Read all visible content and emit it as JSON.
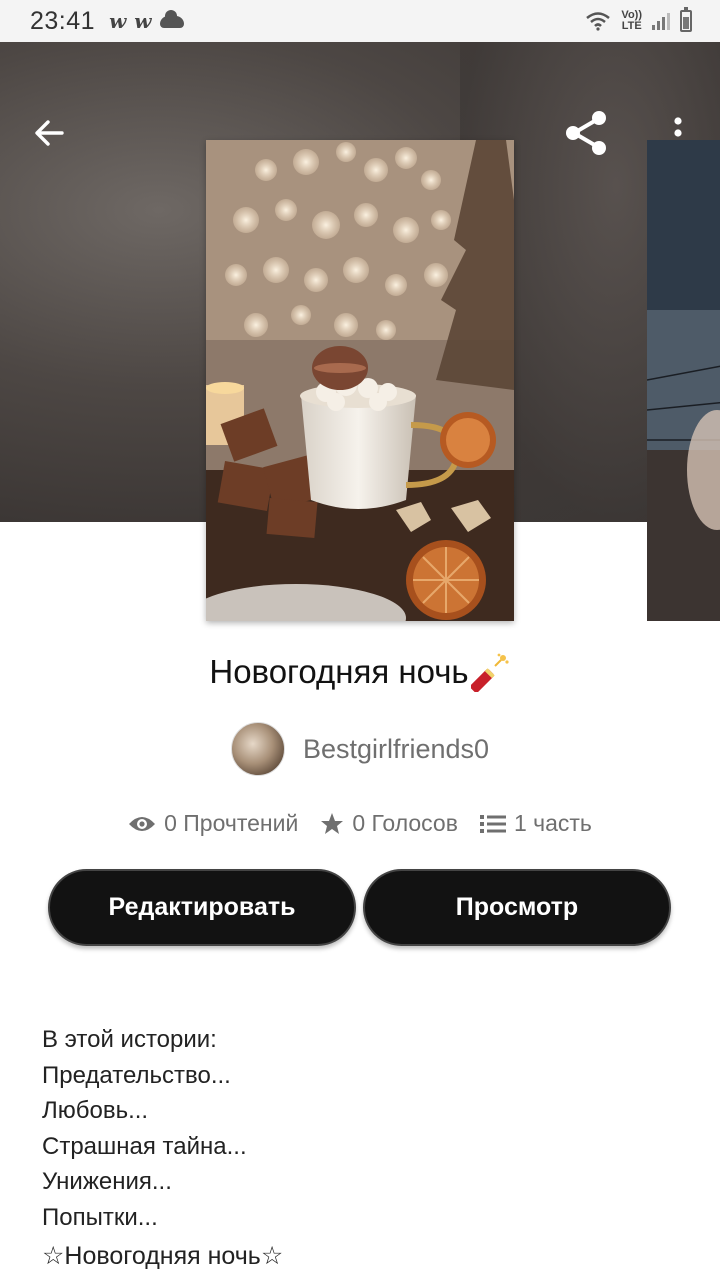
{
  "status_bar": {
    "time": "23:41",
    "left_icons": [
      "w-icon",
      "w-icon",
      "cloud-icon"
    ],
    "network": "LTE",
    "network_top": "Vo))"
  },
  "toolbar": {
    "back_icon": "arrow-left-icon",
    "share_icon": "share-icon",
    "more_icon": "more-vertical-icon"
  },
  "story": {
    "title": "Новогодняя ночь",
    "title_emoji": "firecracker-icon",
    "author": "Bestgirlfriends0",
    "stats": {
      "reads": "0 Прочтений",
      "votes": "0 Голосов",
      "parts": "1 часть"
    }
  },
  "actions": {
    "edit_label": "Редактировать",
    "view_label": "Просмотр"
  },
  "description": [
    "В этой истории:",
    "Предательство...",
    "Любовь...",
    "Страшная тайна...",
    "Унижения...",
    "Попытки...",
    "☆Новогодняя ночь☆"
  ]
}
